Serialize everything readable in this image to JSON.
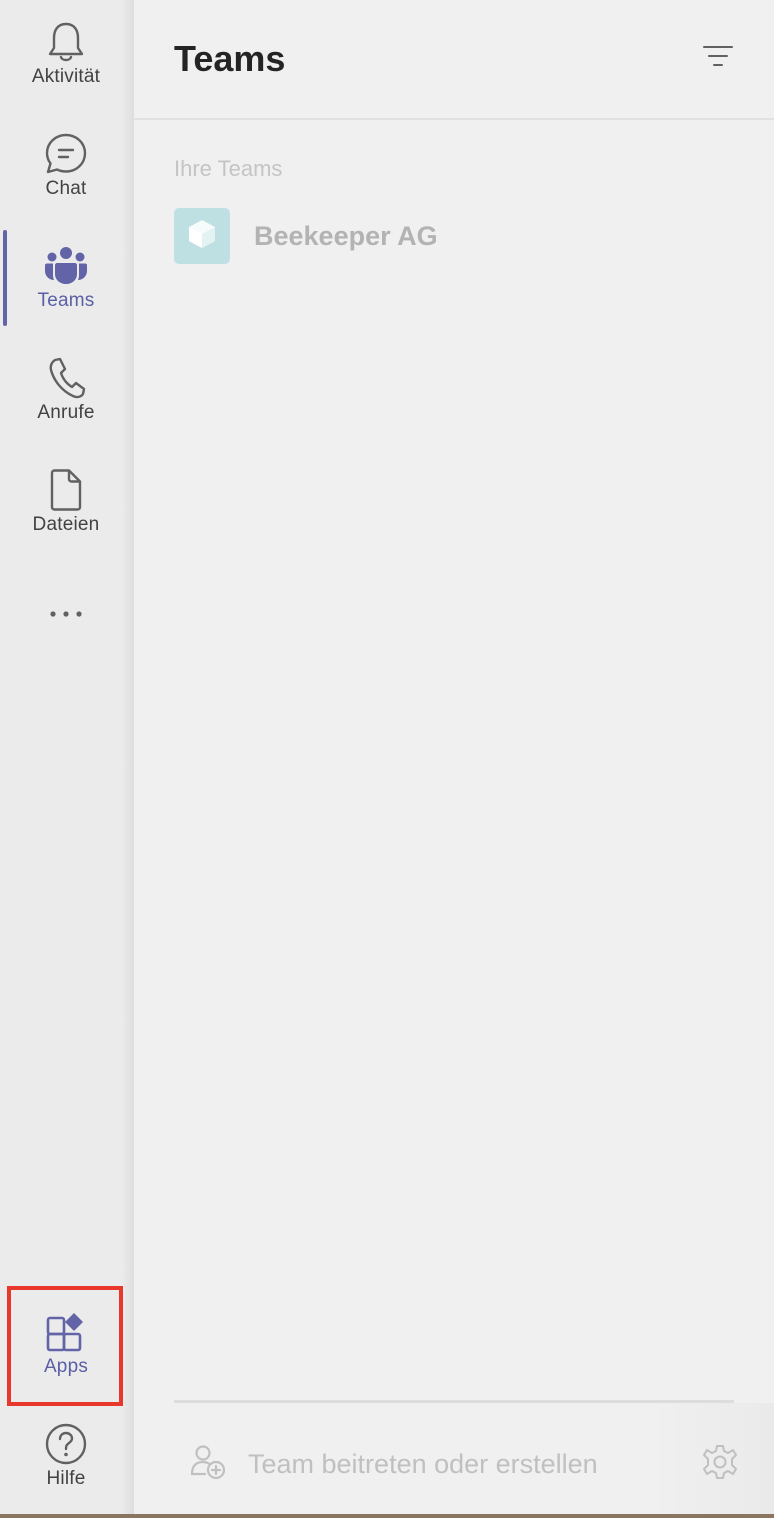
{
  "rail": {
    "items": [
      {
        "label": "Aktivität",
        "icon": "bell-icon"
      },
      {
        "label": "Chat",
        "icon": "chat-icon"
      },
      {
        "label": "Teams",
        "icon": "teams-icon",
        "active": true
      },
      {
        "label": "Anrufe",
        "icon": "phone-icon"
      },
      {
        "label": "Dateien",
        "icon": "file-icon"
      }
    ],
    "more_icon": "more-dots-icon",
    "apps_label": "Apps",
    "apps_icon": "apps-icon",
    "help_label": "Hilfe",
    "help_icon": "help-icon"
  },
  "panel": {
    "title": "Teams",
    "filter_icon": "filter-icon",
    "section_label": "Ihre Teams",
    "teams": [
      {
        "name": "Beekeeper AG",
        "avatar_color": "#bfe0e3"
      }
    ],
    "join_label": "Team beitreten oder erstellen",
    "join_icon": "add-people-icon",
    "settings_icon": "gear-icon"
  },
  "colors": {
    "accent": "#6264a7",
    "highlight_frame": "#e8372b"
  }
}
